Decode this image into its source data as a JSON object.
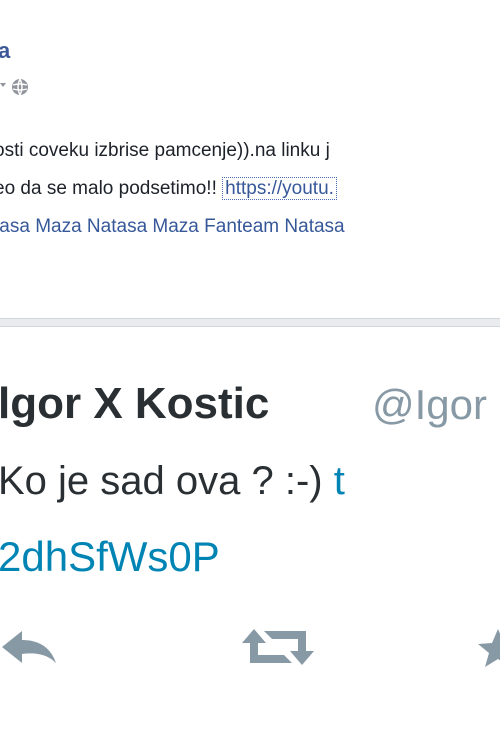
{
  "facebook_post": {
    "author_name": "a",
    "line1": "osti coveku izbrise pamcenje)).na linku j",
    "line2_prefix": "eo da se malo podsetimo!! ",
    "line2_link": "https://youtu.",
    "tags_line": "tasa Maza Natasa Maza Fanteam Natasa"
  },
  "tweet": {
    "name": "lgor X Kostic",
    "handle": "@Igor",
    "text_prefix": "Ko je sad ova ? :-) ",
    "text_link_start": "t",
    "link_rest": "2dhSfWs0P"
  },
  "icons": {
    "privacy": "globe-icon",
    "reply": "reply-icon",
    "retweet": "retweet-icon",
    "favorite": "favorite-icon"
  },
  "colors": {
    "facebook_blue": "#3b5998",
    "link_blue": "#365899",
    "twitter_link": "#0084b4",
    "icon_gray": "#8899a6"
  }
}
